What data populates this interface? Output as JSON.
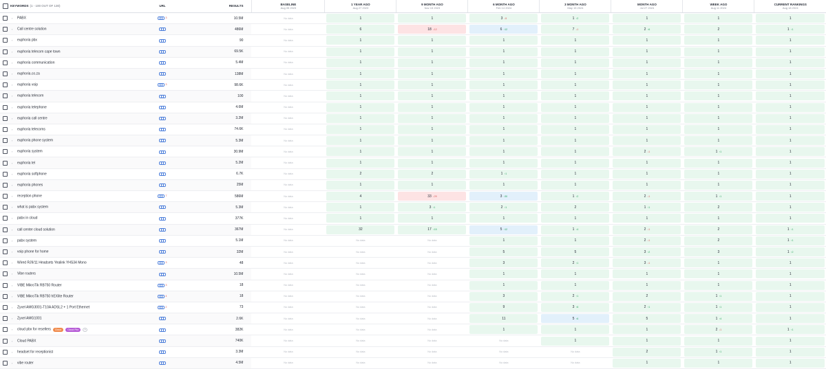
{
  "header": {
    "keywords_label": "KEYWORDS",
    "keywords_count": "(1 - 100 OUT OF 130)",
    "url_label": "URL",
    "results_label": "RESULTS",
    "periods": [
      {
        "label": "BASELINE",
        "date": "Aug 05 2023"
      },
      {
        "label": "1 YEAR AGO",
        "date": "Aug 27 2023"
      },
      {
        "label": "9 MONTH AGO",
        "date": "Nov 15 2023"
      },
      {
        "label": "6 MONTH AGO",
        "date": "Feb 14 2024"
      },
      {
        "label": "3 MONTH AGO",
        "date": "May 15 2024"
      },
      {
        "label": "MONTH AGO",
        "date": "Jul 27 2024"
      },
      {
        "label": "WEEK AGO",
        "date": "Aug 11 2024"
      },
      {
        "label": "CURRENT RANKINGS",
        "date": "Aug 18 2024"
      }
    ]
  },
  "colors": {
    "improved": "#e8f7ee",
    "declined": "#fde3e4",
    "new_entry": "#e2f0fb",
    "up": "#24a35a",
    "down": "#d9534f"
  },
  "no_data_label": "No data",
  "rows": [
    {
      "kw": "PABX",
      "urlc": "3",
      "res": "10.5M",
      "c": [
        [
          "n"
        ],
        [
          "g",
          "1"
        ],
        [
          "g",
          "1"
        ],
        [
          "g",
          "3",
          "5",
          "dn"
        ],
        [
          "g",
          "1",
          "2",
          "up"
        ],
        [
          "g",
          "1"
        ],
        [
          "g",
          "1"
        ],
        [
          "g",
          "1"
        ]
      ]
    },
    {
      "kw": "Call centre solution",
      "urlc": "",
      "res": "486M",
      "c": [
        [
          "n"
        ],
        [
          "g",
          "6"
        ],
        [
          "r",
          "18",
          "12",
          "dn"
        ],
        [
          "b",
          "6",
          "12",
          "up"
        ],
        [
          "g",
          "7",
          "1",
          "dn"
        ],
        [
          "g",
          "2",
          "6",
          "up"
        ],
        [
          "g",
          "2"
        ],
        [
          "g",
          "1",
          "1",
          "up"
        ]
      ]
    },
    {
      "kw": "euphoria pbx",
      "urlc": "",
      "res": "90",
      "c": [
        [
          "n"
        ],
        [
          "g",
          "1"
        ],
        [
          "g",
          "1"
        ],
        [
          "g",
          "1"
        ],
        [
          "g",
          "1"
        ],
        [
          "g",
          "1"
        ],
        [
          "g",
          "1"
        ],
        [
          "g",
          "1"
        ]
      ]
    },
    {
      "kw": "euphoria telecom cape town",
      "urlc": "",
      "res": "69.5K",
      "c": [
        [
          "n"
        ],
        [
          "g",
          "1"
        ],
        [
          "g",
          "1"
        ],
        [
          "g",
          "1"
        ],
        [
          "g",
          "1"
        ],
        [
          "g",
          "1"
        ],
        [
          "g",
          "1"
        ],
        [
          "g",
          "1"
        ]
      ]
    },
    {
      "kw": "euphoria communication",
      "urlc": "",
      "res": "5.4M",
      "c": [
        [
          "n"
        ],
        [
          "g",
          "1"
        ],
        [
          "g",
          "1"
        ],
        [
          "g",
          "1"
        ],
        [
          "g",
          "1"
        ],
        [
          "g",
          "1"
        ],
        [
          "g",
          "1"
        ],
        [
          "g",
          "1"
        ]
      ]
    },
    {
      "kw": "euphoria.co.za",
      "urlc": "",
      "res": "138M",
      "c": [
        [
          "n"
        ],
        [
          "g",
          "1"
        ],
        [
          "g",
          "1"
        ],
        [
          "g",
          "1"
        ],
        [
          "g",
          "1"
        ],
        [
          "g",
          "1"
        ],
        [
          "g",
          "1"
        ],
        [
          "g",
          "1"
        ]
      ]
    },
    {
      "kw": "euphoria voip",
      "urlc": "3",
      "res": "98.6K",
      "c": [
        [
          "n"
        ],
        [
          "g",
          "1"
        ],
        [
          "g",
          "1"
        ],
        [
          "g",
          "1"
        ],
        [
          "g",
          "1"
        ],
        [
          "g",
          "1"
        ],
        [
          "g",
          "1"
        ],
        [
          "g",
          "1"
        ]
      ]
    },
    {
      "kw": "euphoria telecom",
      "urlc": "",
      "res": "100",
      "c": [
        [
          "n"
        ],
        [
          "g",
          "1"
        ],
        [
          "g",
          "1"
        ],
        [
          "g",
          "1"
        ],
        [
          "g",
          "1"
        ],
        [
          "g",
          "1"
        ],
        [
          "g",
          "1"
        ],
        [
          "g",
          "1"
        ]
      ]
    },
    {
      "kw": "euphoria telephone",
      "urlc": "",
      "res": "4.6M",
      "c": [
        [
          "n"
        ],
        [
          "g",
          "1"
        ],
        [
          "g",
          "1"
        ],
        [
          "g",
          "1"
        ],
        [
          "g",
          "1"
        ],
        [
          "g",
          "1"
        ],
        [
          "g",
          "1"
        ],
        [
          "g",
          "1"
        ]
      ]
    },
    {
      "kw": "euphoria call centre",
      "urlc": "",
      "res": "3.2M",
      "c": [
        [
          "n"
        ],
        [
          "g",
          "1"
        ],
        [
          "g",
          "1"
        ],
        [
          "g",
          "1"
        ],
        [
          "g",
          "1"
        ],
        [
          "g",
          "1"
        ],
        [
          "g",
          "1"
        ],
        [
          "g",
          "1"
        ]
      ]
    },
    {
      "kw": "euphoria telecoms",
      "urlc": "",
      "res": "74.6K",
      "c": [
        [
          "n"
        ],
        [
          "g",
          "1"
        ],
        [
          "g",
          "1"
        ],
        [
          "g",
          "1"
        ],
        [
          "g",
          "1"
        ],
        [
          "g",
          "1"
        ],
        [
          "g",
          "1"
        ],
        [
          "g",
          "1"
        ]
      ]
    },
    {
      "kw": "euphoria phone system",
      "urlc": "",
      "res": "5.3M",
      "c": [
        [
          "n"
        ],
        [
          "g",
          "1"
        ],
        [
          "g",
          "1"
        ],
        [
          "g",
          "1"
        ],
        [
          "g",
          "1"
        ],
        [
          "g",
          "1"
        ],
        [
          "g",
          "1"
        ],
        [
          "g",
          "1"
        ]
      ]
    },
    {
      "kw": "euphoria system",
      "urlc": "",
      "res": "30.9M",
      "c": [
        [
          "n"
        ],
        [
          "g",
          "1"
        ],
        [
          "g",
          "1"
        ],
        [
          "g",
          "1"
        ],
        [
          "g",
          "1"
        ],
        [
          "g",
          "2",
          "1",
          "dn"
        ],
        [
          "g",
          "1",
          "1",
          "up"
        ],
        [
          "g",
          "1"
        ]
      ]
    },
    {
      "kw": "euphoria tel",
      "urlc": "",
      "res": "5.2M",
      "c": [
        [
          "n"
        ],
        [
          "g",
          "1"
        ],
        [
          "g",
          "1"
        ],
        [
          "g",
          "1"
        ],
        [
          "g",
          "1"
        ],
        [
          "g",
          "1"
        ],
        [
          "g",
          "1"
        ],
        [
          "g",
          "1"
        ]
      ]
    },
    {
      "kw": "euphoria softphone",
      "urlc": "",
      "res": "6.7K",
      "c": [
        [
          "n"
        ],
        [
          "g",
          "2"
        ],
        [
          "g",
          "2"
        ],
        [
          "g",
          "1",
          "1",
          "up"
        ],
        [
          "g",
          "1"
        ],
        [
          "g",
          "1"
        ],
        [
          "g",
          "1"
        ],
        [
          "g",
          "1"
        ]
      ]
    },
    {
      "kw": "euphoria phones",
      "urlc": "",
      "res": "25M",
      "c": [
        [
          "n"
        ],
        [
          "g",
          "1"
        ],
        [
          "g",
          "1"
        ],
        [
          "g",
          "1"
        ],
        [
          "g",
          "1"
        ],
        [
          "g",
          "1"
        ],
        [
          "g",
          "1"
        ],
        [
          "g",
          "1"
        ]
      ]
    },
    {
      "kw": "reception phone",
      "urlc": "7",
      "res": "586M",
      "c": [
        [
          "n"
        ],
        [
          "g",
          "4"
        ],
        [
          "r",
          "33",
          "29",
          "dn"
        ],
        [
          "b",
          "3",
          "30",
          "up"
        ],
        [
          "g",
          "1",
          "2",
          "up"
        ],
        [
          "g",
          "2",
          "1",
          "dn"
        ],
        [
          "g",
          "1",
          "1",
          "up"
        ],
        [
          "g",
          "1"
        ]
      ]
    },
    {
      "kw": "what is pabx system",
      "urlc": "",
      "res": "5.3M",
      "c": [
        [
          "n"
        ],
        [
          "g",
          "1"
        ],
        [
          "g",
          "3",
          "1",
          "up"
        ],
        [
          "g",
          "2",
          "1",
          "up"
        ],
        [
          "g",
          "2"
        ],
        [
          "g",
          "1",
          "1",
          "up"
        ],
        [
          "g",
          "2"
        ],
        [
          "g",
          "1"
        ]
      ]
    },
    {
      "kw": "pabx in cloud",
      "urlc": "",
      "res": "377K",
      "c": [
        [
          "n"
        ],
        [
          "g",
          "1"
        ],
        [
          "g",
          "1"
        ],
        [
          "g",
          "1"
        ],
        [
          "g",
          "1"
        ],
        [
          "g",
          "1"
        ],
        [
          "g",
          "1"
        ],
        [
          "g",
          "1"
        ]
      ]
    },
    {
      "kw": "call center cloud solution",
      "urlc": "",
      "res": "367M",
      "c": [
        [
          "n"
        ],
        [
          "g",
          "32"
        ],
        [
          "g",
          "17",
          "15",
          "up"
        ],
        [
          "b",
          "5",
          "12",
          "up"
        ],
        [
          "g",
          "1",
          "4",
          "up"
        ],
        [
          "g",
          "2",
          "1",
          "dn"
        ],
        [
          "g",
          "2"
        ],
        [
          "g",
          "1",
          "1",
          "up"
        ]
      ]
    },
    {
      "kw": "pabx system",
      "urlc": "",
      "res": "5.1M",
      "c": [
        [
          "n"
        ],
        [
          "n"
        ],
        [
          "n"
        ],
        [
          "g",
          "1"
        ],
        [
          "g",
          "1"
        ],
        [
          "g",
          "2",
          "1",
          "dn"
        ],
        [
          "g",
          "2"
        ],
        [
          "g",
          "1",
          "1",
          "up"
        ]
      ]
    },
    {
      "kw": "voip phone for home",
      "urlc": "",
      "res": "32M",
      "c": [
        [
          "n"
        ],
        [
          "n"
        ],
        [
          "n"
        ],
        [
          "g",
          "5"
        ],
        [
          "g",
          "5"
        ],
        [
          "g",
          "3",
          "2",
          "up"
        ],
        [
          "g",
          "3"
        ],
        [
          "g",
          "1",
          "2",
          "up"
        ]
      ]
    },
    {
      "kw": "Wired RJ9/11 Headsets Yealink YHS34 Mono",
      "urlc": "3",
      "res": "48",
      "c": [
        [
          "n"
        ],
        [
          "n"
        ],
        [
          "n"
        ],
        [
          "g",
          "3"
        ],
        [
          "g",
          "2",
          "1",
          "up"
        ],
        [
          "g",
          "3",
          "1",
          "dn"
        ],
        [
          "g",
          "1"
        ],
        [
          "g",
          "1"
        ]
      ]
    },
    {
      "kw": "Vibe routers",
      "urlc": "",
      "res": "10.5M",
      "c": [
        [
          "n"
        ],
        [
          "n"
        ],
        [
          "n"
        ],
        [
          "g",
          "1"
        ],
        [
          "g",
          "1"
        ],
        [
          "g",
          "1"
        ],
        [
          "g",
          "1"
        ],
        [
          "g",
          "1"
        ]
      ]
    },
    {
      "kw": "VIBE MikroTik RB750 Router",
      "urlc": "3",
      "res": "18",
      "c": [
        [
          "n"
        ],
        [
          "n"
        ],
        [
          "n"
        ],
        [
          "g",
          "1"
        ],
        [
          "g",
          "1"
        ],
        [
          "g",
          "1"
        ],
        [
          "g",
          "1"
        ],
        [
          "g",
          "1"
        ]
      ]
    },
    {
      "kw": "VIBE MikroTik RB750 hEXlite Router",
      "urlc": "4",
      "res": "18",
      "c": [
        [
          "n"
        ],
        [
          "n"
        ],
        [
          "n"
        ],
        [
          "g",
          "3"
        ],
        [
          "g",
          "2",
          "1",
          "up"
        ],
        [
          "g",
          "2"
        ],
        [
          "g",
          "1",
          "1",
          "up"
        ],
        [
          "g",
          "1"
        ]
      ]
    },
    {
      "kw": "Zyxel AMG3001-T10A ADSL2 + 1 Port Ethernet",
      "urlc": "2",
      "res": "73",
      "c": [
        [
          "n"
        ],
        [
          "n"
        ],
        [
          "n"
        ],
        [
          "g",
          "9"
        ],
        [
          "g",
          "3",
          "6",
          "up"
        ],
        [
          "g",
          "2",
          "1",
          "up"
        ],
        [
          "g",
          "1",
          "1",
          "up"
        ],
        [
          "g",
          "1"
        ]
      ]
    },
    {
      "kw": "Zyxel AMG1001",
      "urlc": "",
      "res": "2.6K",
      "c": [
        [
          "n"
        ],
        [
          "n"
        ],
        [
          "n"
        ],
        [
          "g",
          "11"
        ],
        [
          "b",
          "5",
          "6",
          "up"
        ],
        [
          "g",
          "5"
        ],
        [
          "g",
          "1",
          "4",
          "up"
        ],
        [
          "g",
          "1"
        ]
      ]
    },
    {
      "kw": "cloud pbx for resellers",
      "urlc": "",
      "res": "382K",
      "tags": [
        "Cloud",
        "Cloud Pbx"
      ],
      "c": [
        [
          "n"
        ],
        [
          "n"
        ],
        [
          "n"
        ],
        [
          "g",
          "1"
        ],
        [
          "g",
          "1"
        ],
        [
          "g",
          "1"
        ],
        [
          "g",
          "2",
          "1",
          "dn"
        ],
        [
          "g",
          "1",
          "1",
          "up"
        ]
      ]
    },
    {
      "kw": "Cloud PABX",
      "urlc": "",
      "res": "740K",
      "c": [
        [
          "n"
        ],
        [
          "n"
        ],
        [
          "n"
        ],
        [
          "n"
        ],
        [
          "g",
          "1"
        ],
        [
          "g",
          "1"
        ],
        [
          "g",
          "1"
        ],
        [
          "g",
          "1"
        ]
      ]
    },
    {
      "kw": "headset for receptionist",
      "urlc": "",
      "res": "3.3M",
      "c": [
        [
          "n"
        ],
        [
          "n"
        ],
        [
          "n"
        ],
        [
          "n"
        ],
        [
          "n"
        ],
        [
          "g",
          "2"
        ],
        [
          "g",
          "1",
          "1",
          "up"
        ],
        [
          "g",
          "1"
        ]
      ]
    },
    {
      "kw": "vibe router",
      "urlc": "",
      "res": "4.5M",
      "c": [
        [
          "n"
        ],
        [
          "n"
        ],
        [
          "n"
        ],
        [
          "n"
        ],
        [
          "n"
        ],
        [
          "g",
          "1"
        ],
        [
          "g",
          "1"
        ],
        [
          "g",
          "1"
        ]
      ]
    }
  ]
}
